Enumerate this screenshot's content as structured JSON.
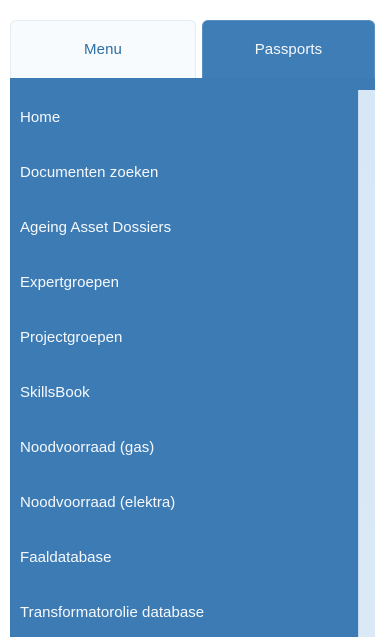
{
  "tabs": [
    {
      "label": "Menu"
    },
    {
      "label": "Passports"
    }
  ],
  "menu": {
    "items": [
      {
        "label": "Home"
      },
      {
        "label": "Documenten zoeken"
      },
      {
        "label": "Ageing Asset Dossiers"
      },
      {
        "label": "Expertgroepen"
      },
      {
        "label": "Projectgroepen"
      },
      {
        "label": "SkillsBook"
      },
      {
        "label": "Noodvoorraad (gas)"
      },
      {
        "label": "Noodvoorraad (elektra)"
      },
      {
        "label": "Faaldatabase"
      },
      {
        "label": "Transformatorolie database"
      }
    ]
  },
  "colors": {
    "panel": "#3d7bb4",
    "active_tab": "#f8fbfd",
    "inactive_tab": "#3f7db6",
    "text_light": "#f4f8fc",
    "scrollbar": "#dbe9f6"
  }
}
